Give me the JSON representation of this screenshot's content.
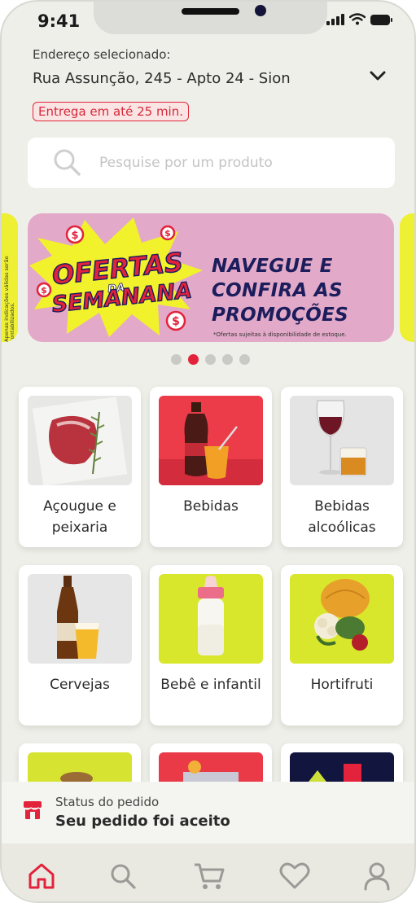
{
  "status_bar": {
    "time": "9:41"
  },
  "address": {
    "label": "Endereço selecionado:",
    "value": "Rua Assunção, 245 - Apto 24 - Sion"
  },
  "delivery_badge": "Entrega em até 25 min.",
  "search": {
    "placeholder": "Pesquise por um produto"
  },
  "banner": {
    "logo_text_line1": "OFERTAS",
    "logo_text_line2": "DA",
    "logo_text_line3": "SEMANANA",
    "headline": "NAVEGUE E CONFIRA AS PROMOÇÕES",
    "footnote": "*Ofertas sujeitas à disponibilidade de estoque.",
    "side_note": "Apenas indicações válidas serão contabilizados.",
    "carousel": {
      "total": 5,
      "active_index": 1
    }
  },
  "categories": [
    {
      "label": "Açougue e peixaria"
    },
    {
      "label": "Bebidas"
    },
    {
      "label": "Bebidas alcoólicas"
    },
    {
      "label": "Cervejas"
    },
    {
      "label": "Bebê e infantil"
    },
    {
      "label": "Hortifruti"
    }
  ],
  "order_status": {
    "label": "Status do pedido",
    "value": "Seu pedido foi aceito"
  },
  "nav": {
    "items": [
      "home-icon",
      "search-icon",
      "cart-icon",
      "heart-icon",
      "profile-icon"
    ],
    "active": "home-icon"
  },
  "colors": {
    "accent": "#e3223c",
    "background": "#efefe9",
    "banner": "#e3a9c8",
    "highlight_yellow": "#eef033",
    "navy": "#1b1d5c"
  }
}
